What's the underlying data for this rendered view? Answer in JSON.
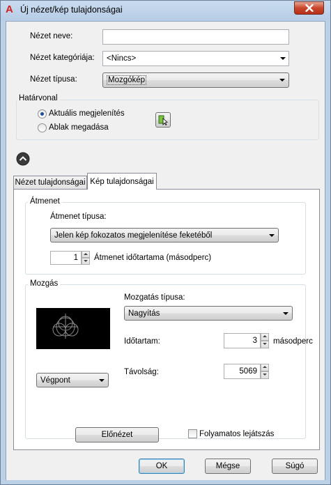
{
  "window": {
    "title": "Új nézet/kép tulajdonságai",
    "app_icon_glyph": "A",
    "brand_color": "#d41f1f"
  },
  "form": {
    "view_name_label": "Nézet neve:",
    "view_name_value": "",
    "view_category_label": "Nézet kategóriája:",
    "view_category_value": "<Nincs>",
    "view_type_label": "Nézet típusa:",
    "view_type_value": "Mozgókép"
  },
  "boundary": {
    "title": "Határvonal",
    "options": [
      {
        "label": "Aktuális megjelenítés",
        "checked": true
      },
      {
        "label": "Ablak megadása",
        "checked": false
      }
    ]
  },
  "tabs": [
    {
      "label": "Nézet tulajdonságai",
      "active": false
    },
    {
      "label": "Kép tulajdonságai",
      "active": true
    }
  ],
  "transition": {
    "title": "Átmenet",
    "type_label": "Átmenet típusa:",
    "type_value": "Jelen kép fokozatos megjelenítése feketéből",
    "duration_value": "1",
    "duration_label": "Átmenet időtartama (másodperc)"
  },
  "motion": {
    "title": "Mozgás",
    "type_label": "Mozgatás típusa:",
    "type_value": "Nagyítás",
    "duration_label": "Időtartam:",
    "duration_value": "3",
    "duration_unit": "másodperc",
    "distance_label": "Távolság:",
    "distance_value": "5069",
    "point_value": "Végpont"
  },
  "preview": {
    "button_label": "Előnézet",
    "loop_label": "Folyamatos lejátszás",
    "loop_checked": false
  },
  "footer": {
    "ok_label": "OK",
    "cancel_label": "Mégse",
    "help_label": "Súgó"
  }
}
